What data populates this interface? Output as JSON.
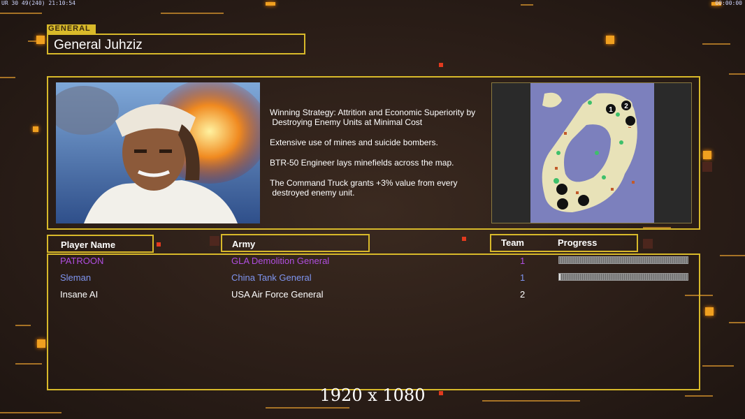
{
  "hud": {
    "left_text": "UR 30 49(240) 21:10:54",
    "right_text": "00:00:00"
  },
  "general": {
    "tag": "GENERAL",
    "name": "General Juhziz"
  },
  "strategy": {
    "lines": [
      "Winning Strategy: Attrition and Economic Superiority by\n Destroying Enemy Units at Minimal Cost",
      "Extensive use of mines and suicide bombers.",
      "BTR-50 Engineer lays minefields across the map.",
      "The Command Truck grants +3% value from every\n destroyed enemy unit."
    ]
  },
  "map": {
    "start_markers": [
      "1",
      "2"
    ]
  },
  "columns": {
    "player_name": "Player Name",
    "army": "Army",
    "team": "Team",
    "progress": "Progress"
  },
  "players": [
    {
      "name": "PATROON",
      "army": "GLA Demolition General",
      "team": "1",
      "color": "#b04ee0",
      "progress": 0.0
    },
    {
      "name": "Sleman",
      "army": "China Tank General",
      "team": "1",
      "color": "#7f95f0",
      "progress": 0.01
    },
    {
      "name": "Insane AI",
      "army": "USA Air Force General",
      "team": "2",
      "color": "#ffffff",
      "progress": null
    }
  ],
  "resolution_label": "1920 x 1080",
  "colors": {
    "frame": "#d8b92a",
    "accent_orange": "#f0a020",
    "accent_red": "#e23a1e"
  }
}
